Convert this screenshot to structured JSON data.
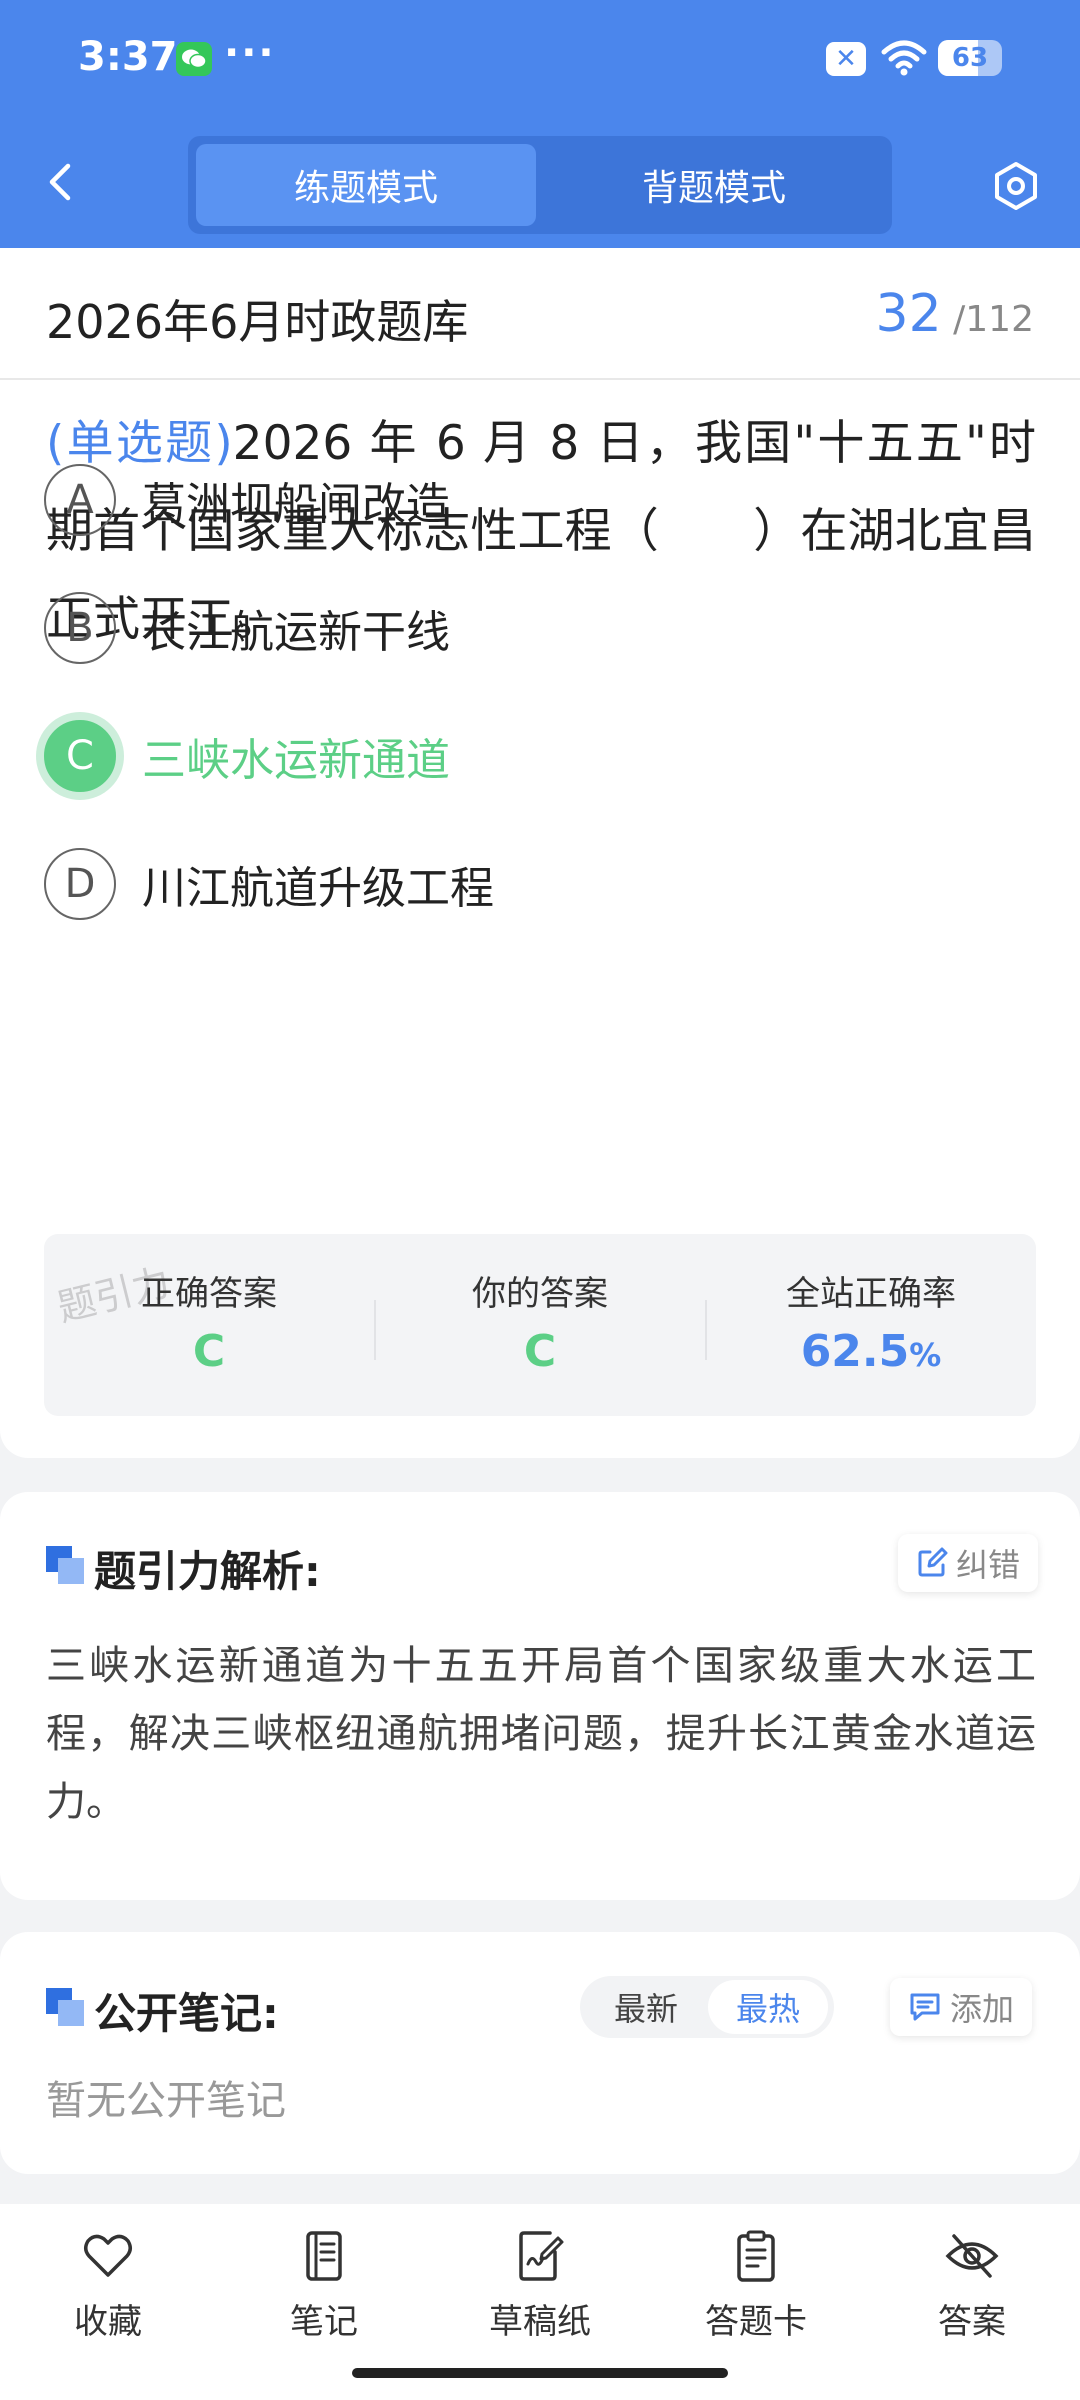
{
  "status_bar": {
    "time": "3:37",
    "more": "···",
    "battery": "63",
    "battery_level": 0.63
  },
  "header": {
    "tabs": [
      {
        "label": "练题模式",
        "active": true
      },
      {
        "label": "背题模式",
        "active": false
      }
    ]
  },
  "question_bank": {
    "title": "2026年6月时政题库",
    "current": "32",
    "separator": "/",
    "total": "112"
  },
  "question": {
    "type": "(单选题)",
    "text": "2026 年 6 月 8 日，我国\"十五五\"时期首个国家重大标志性工程（　　）在湖北宜昌正式开工。",
    "options": [
      {
        "letter": "A",
        "text": "葛洲坝船闸改造",
        "state": "normal"
      },
      {
        "letter": "B",
        "text": "长江航运新干线",
        "state": "normal"
      },
      {
        "letter": "C",
        "text": "三峡水运新通道",
        "state": "correct"
      },
      {
        "letter": "D",
        "text": "川江航道升级工程",
        "state": "normal"
      }
    ]
  },
  "stats": {
    "watermark": "题引力",
    "correct_answer_label": "正确答案",
    "correct_answer": "C",
    "your_answer_label": "你的答案",
    "your_answer": "C",
    "rate_label": "全站正确率",
    "rate_value": "62.5",
    "rate_unit": "%"
  },
  "analysis": {
    "title": "题引力解析:",
    "report_label": "纠错",
    "text": "三峡水运新通道为十五五开局首个国家级重大水运工程，解决三峡枢纽通航拥堵问题，提升长江黄金水道运力。"
  },
  "notes": {
    "title": "公开笔记:",
    "sort_latest": "最新",
    "sort_hot": "最热",
    "add_label": "添加",
    "empty_text": "暂无公开笔记"
  },
  "bottom_nav": [
    {
      "label": "收藏",
      "icon": "heart-icon"
    },
    {
      "label": "笔记",
      "icon": "notebook-icon"
    },
    {
      "label": "草稿纸",
      "icon": "draft-paper-icon"
    },
    {
      "label": "答题卡",
      "icon": "answer-card-icon"
    },
    {
      "label": "答案",
      "icon": "eye-off-icon"
    }
  ],
  "colors": {
    "primary": "#4b86ec",
    "correct": "#5ccf86"
  }
}
